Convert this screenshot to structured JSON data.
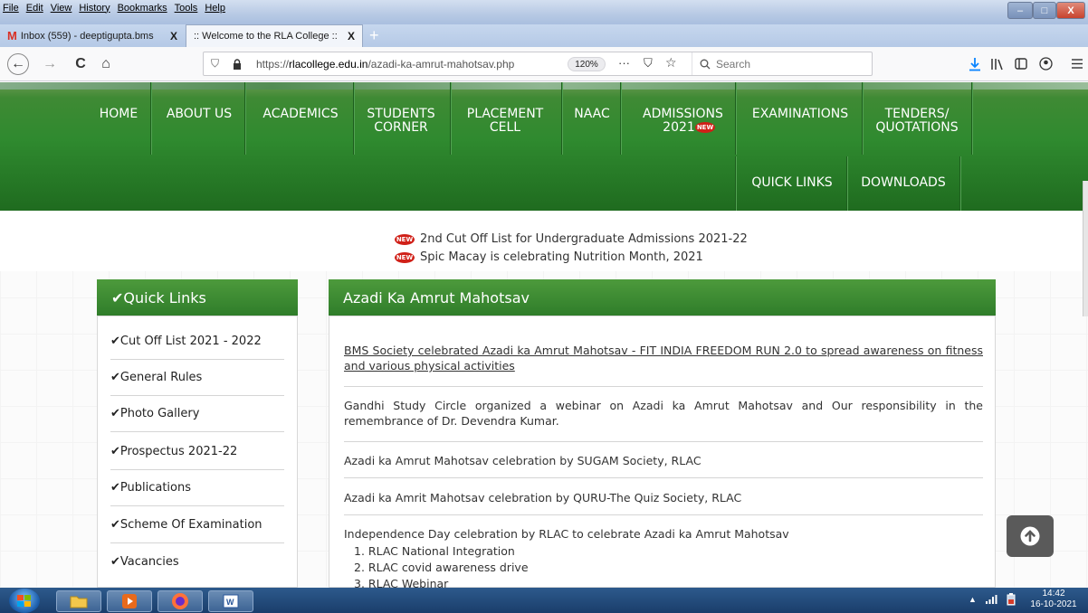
{
  "window": {
    "menu": [
      "File",
      "Edit",
      "View",
      "History",
      "Bookmarks",
      "Tools",
      "Help"
    ],
    "title": "(none)",
    "controls": {
      "minimize": "–",
      "maximize": "□",
      "close": "X"
    }
  },
  "tabs": [
    {
      "label": "Inbox (559) - deeptigupta.bms",
      "close": "X"
    },
    {
      "label": ":: Welcome to the RLA College ::",
      "close": "X"
    },
    {
      "label": "+"
    }
  ],
  "toolbar": {
    "back": "←",
    "forward": "→",
    "reload": "C",
    "home": "⌂",
    "url_prefix": "https://",
    "url_domain": "rlacollege.edu.in",
    "url_path": "/azadi-ka-amrut-mahotsav.php",
    "zoom": "120%",
    "more": "···",
    "search_placeholder": "Search"
  },
  "site_nav": {
    "row1": [
      {
        "label": "HOME"
      },
      {
        "label": "ABOUT US"
      },
      {
        "label": "ACADEMICS"
      },
      {
        "label": "STUDENTS CORNER"
      },
      {
        "label": "PLACEMENT CELL"
      },
      {
        "label": "NAAC"
      },
      {
        "label": "ADMISSIONS 2021"
      },
      {
        "label": "EXAMINATIONS"
      },
      {
        "label": "TENDERS/ QUOTATIONS"
      }
    ],
    "row2": [
      {
        "label": "QUICK LINKS"
      },
      {
        "label": "DOWNLOADS"
      }
    ],
    "new_badge": "NEW"
  },
  "news": [
    "2nd Cut Off List for Undergraduate Admissions 2021-22",
    "Spic Macay is celebrating Nutrition Month, 2021"
  ],
  "quick_links": {
    "title": "✔Quick Links",
    "items": [
      "✔Cut Off List 2021 - 2022",
      "✔General Rules",
      "✔Photo Gallery",
      "✔Prospectus 2021-22",
      "✔Publications",
      "✔Scheme Of Examination",
      "✔Vacancies"
    ]
  },
  "main": {
    "title": "Azadi Ka Amrut Mahotsav",
    "articles": [
      "BMS Society celebrated Azadi ka Amrut Mahotsav - FIT INDIA FREEDOM RUN 2.0 to spread awareness on fitness and various physical activities",
      "Gandhi Study Circle organized a webinar on Azadi ka Amrut Mahotsav and Our responsibility in the remembrance of Dr. Devendra Kumar.",
      "Azadi ka Amrut Mahotsav celebration by SUGAM Society, RLAC",
      "Azadi ka Amrit Mahotsav celebration by QURU-The Quiz Society, RLAC",
      "Independence Day celebration by RLAC to celebrate Azadi ka Amrut Mahotsav"
    ],
    "sublist": [
      "1. RLAC National Integration",
      "2. RLAC covid awareness drive",
      "3. RLAC Webinar"
    ]
  },
  "taskbar": {
    "time": "14:42",
    "date": "16-10-2021"
  },
  "colors": {
    "nav_green": "#2f8a2f",
    "panel_green": "#3f8c33",
    "new_red": "#d02018"
  }
}
